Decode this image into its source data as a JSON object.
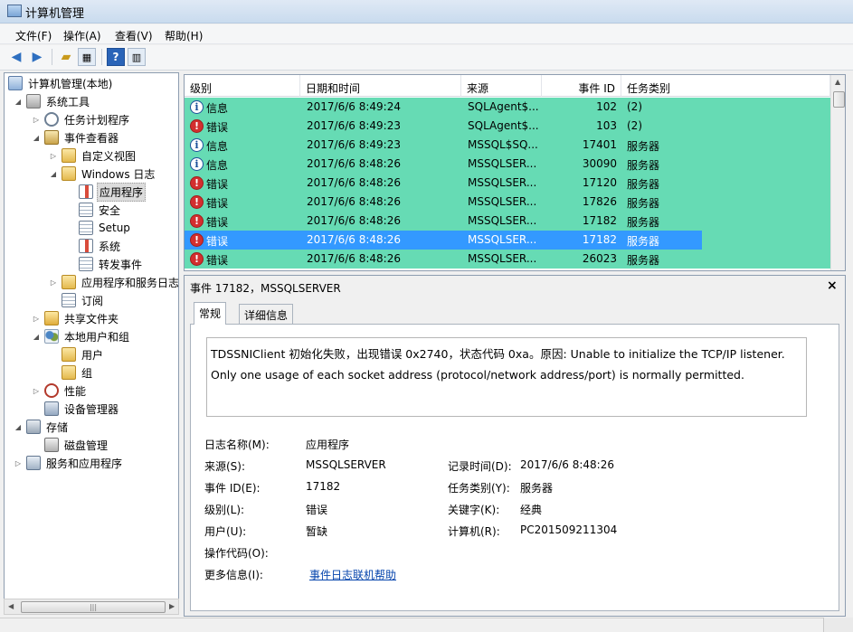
{
  "window": {
    "title": "计算机管理"
  },
  "menu": [
    {
      "label": "文件(F)"
    },
    {
      "label": "操作(A)"
    },
    {
      "label": "查看(V)"
    },
    {
      "label": "帮助(H)"
    }
  ],
  "toolbar": {
    "icons": [
      "back-arrow-icon",
      "forward-arrow-icon",
      "up-folder-icon",
      "show-hide-tree-icon",
      "help-icon",
      "show-hide-action-pane-icon"
    ]
  },
  "tree": [
    {
      "label": "计算机管理(本地)",
      "icon": "computer-icon"
    },
    {
      "label": "系统工具",
      "icon": "tools-icon"
    },
    {
      "label": "任务计划程序",
      "icon": "clock-icon"
    },
    {
      "label": "事件查看器",
      "icon": "event-viewer-icon"
    },
    {
      "label": "自定义视图",
      "icon": "folder-icon"
    },
    {
      "label": "Windows 日志",
      "icon": "folder-icon"
    },
    {
      "label": "应用程序",
      "icon": "log-icon"
    },
    {
      "label": "安全",
      "icon": "log-icon"
    },
    {
      "label": "Setup",
      "icon": "log-icon"
    },
    {
      "label": "系统",
      "icon": "log-icon"
    },
    {
      "label": "转发事件",
      "icon": "log-icon"
    },
    {
      "label": "应用程序和服务日志",
      "icon": "folder-icon"
    },
    {
      "label": "订阅",
      "icon": "log-icon"
    },
    {
      "label": "共享文件夹",
      "icon": "share-folder-icon"
    },
    {
      "label": "本地用户和组",
      "icon": "users-icon"
    },
    {
      "label": "用户",
      "icon": "folder-icon"
    },
    {
      "label": "组",
      "icon": "folder-icon"
    },
    {
      "label": "性能",
      "icon": "performance-icon"
    },
    {
      "label": "设备管理器",
      "icon": "device-manager-icon"
    },
    {
      "label": "存储",
      "icon": "storage-icon"
    },
    {
      "label": "磁盘管理",
      "icon": "disk-icon"
    },
    {
      "label": "服务和应用程序",
      "icon": "services-icon"
    }
  ],
  "grid": {
    "headers": [
      "级别",
      "日期和时间",
      "来源",
      "事件 ID",
      "任务类别"
    ],
    "row_color": "#66dbb4",
    "selection_color": "#3399ff",
    "rows": [
      {
        "level": "信息",
        "type": "info",
        "datetime": "2017/6/6 8:49:24",
        "source": "SQLAgent$...",
        "event_id": "102",
        "category": "(2)"
      },
      {
        "level": "错误",
        "type": "error",
        "datetime": "2017/6/6 8:49:23",
        "source": "SQLAgent$...",
        "event_id": "103",
        "category": "(2)"
      },
      {
        "level": "信息",
        "type": "info",
        "datetime": "2017/6/6 8:49:23",
        "source": "MSSQL$SQ...",
        "event_id": "17401",
        "category": "服务器"
      },
      {
        "level": "信息",
        "type": "info",
        "datetime": "2017/6/6 8:48:26",
        "source": "MSSQLSER...",
        "event_id": "30090",
        "category": "服务器"
      },
      {
        "level": "错误",
        "type": "error",
        "datetime": "2017/6/6 8:48:26",
        "source": "MSSQLSER...",
        "event_id": "17120",
        "category": "服务器"
      },
      {
        "level": "错误",
        "type": "error",
        "datetime": "2017/6/6 8:48:26",
        "source": "MSSQLSER...",
        "event_id": "17826",
        "category": "服务器"
      },
      {
        "level": "错误",
        "type": "error",
        "datetime": "2017/6/6 8:48:26",
        "source": "MSSQLSER...",
        "event_id": "17182",
        "category": "服务器"
      },
      {
        "level": "错误",
        "type": "error",
        "datetime": "2017/6/6 8:48:26",
        "source": "MSSQLSER...",
        "event_id": "17182",
        "category": "服务器",
        "selected": true
      },
      {
        "level": "错误",
        "type": "error",
        "datetime": "2017/6/6 8:48:26",
        "source": "MSSQLSER...",
        "event_id": "26023",
        "category": "服务器"
      }
    ]
  },
  "detail": {
    "title": "事件 17182，MSSQLSERVER",
    "close": "×",
    "tabs": [
      "常规",
      "详细信息"
    ],
    "message": "TDSSNIClient 初始化失败，出现错误 0x2740，状态代码 0xa。原因: Unable to initialize the TCP/IP listener. Only one usage of each socket address (protocol/network address/port) is normally permitted.",
    "fields": {
      "log_name_label": "日志名称(M):",
      "log_name": "应用程序",
      "source_label": "来源(S):",
      "source": "MSSQLSERVER",
      "logged_label": "记录时间(D):",
      "logged": "2017/6/6 8:48:26",
      "event_id_label": "事件 ID(E):",
      "event_id": "17182",
      "task_label": "任务类别(Y):",
      "task": "服务器",
      "level_label": "级别(L):",
      "level": "错误",
      "keywords_label": "关键字(K):",
      "keywords": "经典",
      "user_label": "用户(U):",
      "user": "暂缺",
      "computer_label": "计算机(R):",
      "computer": "PC201509211304",
      "opcode_label": "操作代码(O):",
      "more_info_label": "更多信息(I):",
      "more_info_link": "事件日志联机帮助"
    }
  }
}
